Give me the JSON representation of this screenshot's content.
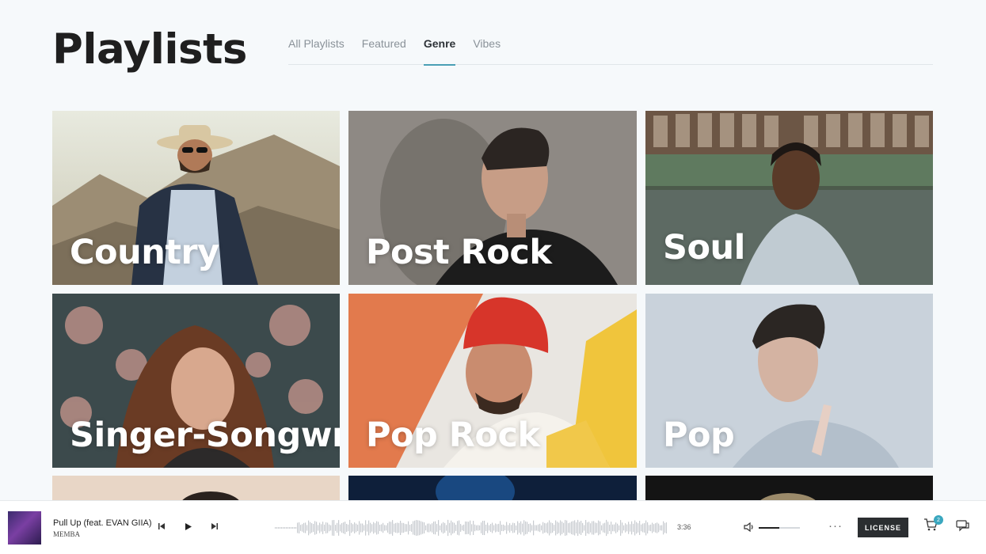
{
  "page": {
    "title": "Playlists"
  },
  "tabs": [
    {
      "label": "All Playlists",
      "active": false
    },
    {
      "label": "Featured",
      "active": false
    },
    {
      "label": "Genre",
      "active": true
    },
    {
      "label": "Vibes",
      "active": false
    }
  ],
  "playlists": [
    {
      "label": "Country"
    },
    {
      "label": "Post Rock"
    },
    {
      "label": "Soul"
    },
    {
      "label": "Singer-Songwriter"
    },
    {
      "label": "Pop Rock"
    },
    {
      "label": "Pop"
    }
  ],
  "player": {
    "track_title": "Pull Up (feat. EVAN GIIA)",
    "artist": "MEMBA",
    "duration": "3:36",
    "volume_level": 0.5,
    "license_label": "LICENSE",
    "cart_count": "2",
    "icons": {
      "prev": "skip-back-icon",
      "play": "play-icon",
      "next": "skip-forward-icon",
      "volume": "volume-icon",
      "more": "more-dots-icon",
      "cart": "cart-icon",
      "chat": "chat-icon"
    }
  },
  "colors": {
    "accent": "#4a9fb5",
    "background": "#f6f9fb",
    "license_button": "#2b2e31"
  }
}
